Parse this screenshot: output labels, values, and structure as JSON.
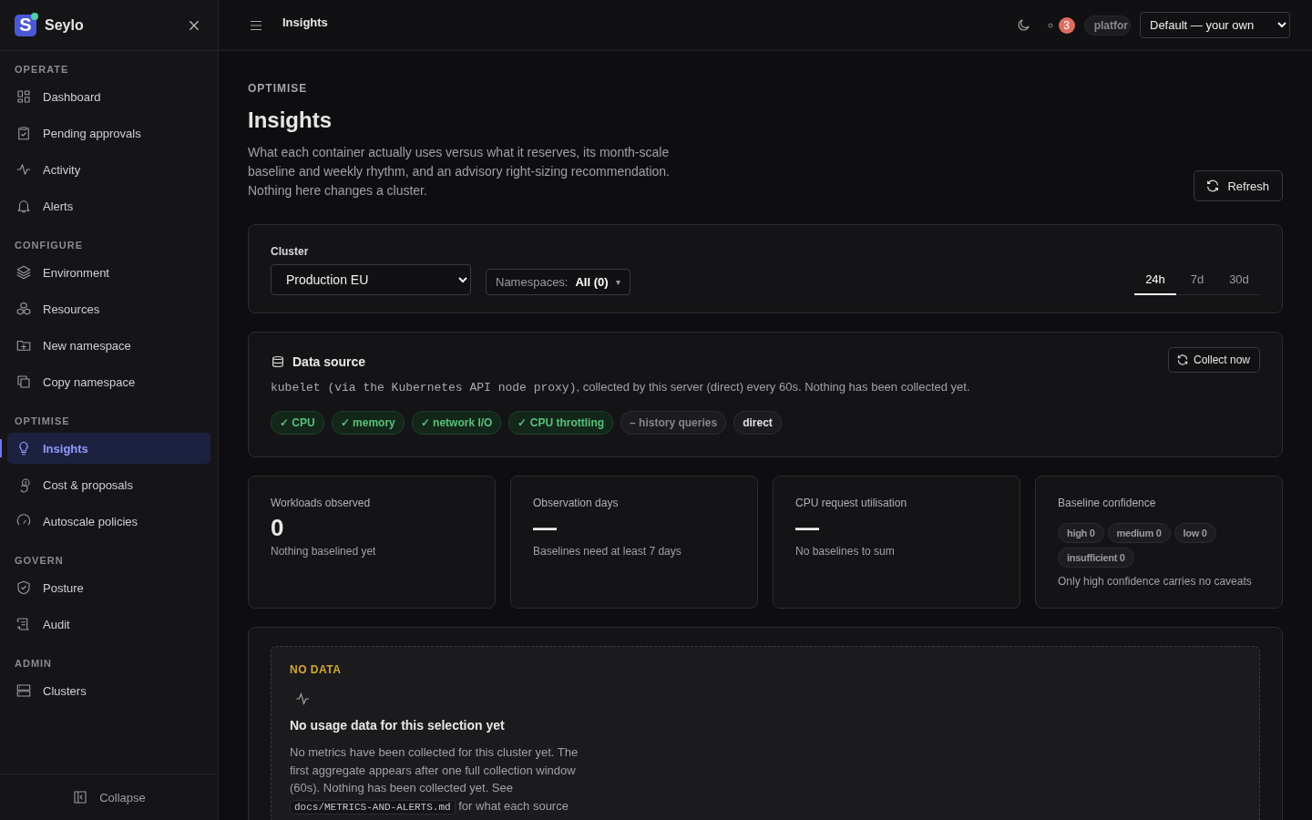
{
  "brand": {
    "name": "Seylo",
    "logo_letter": "S"
  },
  "sidebar": {
    "groups": [
      {
        "title": "OPERATE",
        "items": [
          {
            "label": "Dashboard",
            "selected": false
          },
          {
            "label": "Pending approvals",
            "selected": false
          },
          {
            "label": "Activity",
            "selected": false
          },
          {
            "label": "Alerts",
            "selected": false
          }
        ]
      },
      {
        "title": "CONFIGURE",
        "items": [
          {
            "label": "Environment",
            "selected": false
          },
          {
            "label": "Resources",
            "selected": false
          },
          {
            "label": "New namespace",
            "selected": false
          },
          {
            "label": "Copy namespace",
            "selected": false
          }
        ]
      },
      {
        "title": "OPTIMISE",
        "items": [
          {
            "label": "Insights",
            "selected": true
          },
          {
            "label": "Cost & proposals",
            "selected": false
          },
          {
            "label": "Autoscale policies",
            "selected": false
          }
        ]
      },
      {
        "title": "GOVERN",
        "items": [
          {
            "label": "Posture",
            "selected": false
          },
          {
            "label": "Audit",
            "selected": false
          }
        ]
      },
      {
        "title": "ADMIN",
        "items": [
          {
            "label": "Clusters",
            "selected": false
          }
        ]
      }
    ],
    "collapse": "Collapse"
  },
  "topbar": {
    "title": "Insights",
    "notifications": "3",
    "user_chip": "platfor",
    "profile_select": "Default — your own"
  },
  "header": {
    "eyebrow": "OPTIMISE",
    "title": "Insights",
    "description": "What each container actually uses versus what it reserves, its month-scale baseline and weekly rhythm, and an advisory right-sizing recommendation. Nothing here changes a cluster.",
    "refresh": "Refresh"
  },
  "filters": {
    "cluster_label": "Cluster",
    "cluster": "Production EU",
    "namespaces_label": "Namespaces:",
    "namespaces_value": "All (0)",
    "namespaces_caret": "▾",
    "ranges": [
      {
        "label": "24h",
        "selected": true
      },
      {
        "label": "7d",
        "selected": false
      },
      {
        "label": "30d",
        "selected": false
      }
    ]
  },
  "data_source": {
    "title": "Data source",
    "source_code": "kubelet (via the Kubernetes API node proxy)",
    "description": ", collected by this server (direct) every 60s. Nothing has been collected yet.",
    "collect": "Collect now",
    "chips": [
      {
        "kind": "available",
        "mark": "✓",
        "label": "CPU"
      },
      {
        "kind": "available",
        "mark": "✓",
        "label": "memory"
      },
      {
        "kind": "available",
        "mark": "✓",
        "label": "network I/O"
      },
      {
        "kind": "available",
        "mark": "✓",
        "label": "CPU throttling"
      },
      {
        "kind": "unavailable",
        "mark": "–",
        "label": "history queries"
      },
      {
        "kind": "mode",
        "label": "direct"
      }
    ]
  },
  "stats": [
    {
      "kind": "number",
      "label": "Workloads observed",
      "value": "0",
      "note": "Nothing baselined yet"
    },
    {
      "kind": "empty",
      "label": "Observation days",
      "value": "—",
      "note": "Baselines need at least 7 days"
    },
    {
      "kind": "empty",
      "label": "CPU request utilisation",
      "value": "—",
      "note": "No baselines to sum"
    },
    {
      "kind": "chips",
      "label": "Baseline confidence",
      "chips": [
        "high 0",
        "medium 0",
        "low 0",
        "insufficient 0"
      ],
      "note": "Only high confidence carries no caveats"
    }
  ],
  "empty_state": {
    "eyebrow": "NO DATA",
    "title": "No usage data for this selection yet",
    "text_before": "No metrics have been collected for this cluster yet. The first aggregate appears after one full collection window (60s). Nothing has been collected yet. See ",
    "code": "docs/METRICS-AND-ALERTS.md",
    "text_after": " for what each source"
  }
}
